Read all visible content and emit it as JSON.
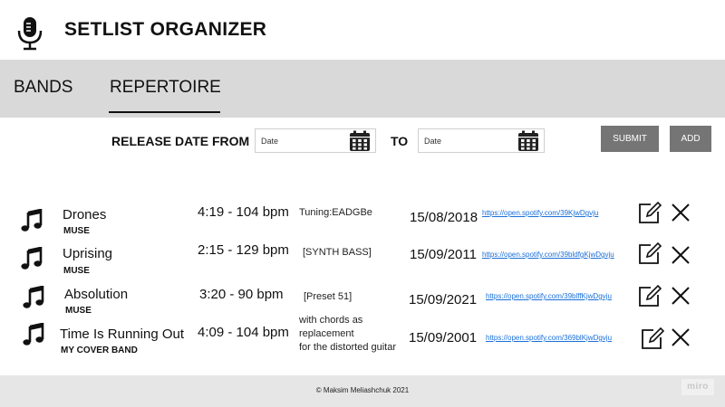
{
  "app": {
    "title": "SETLIST ORGANIZER",
    "logo_icon": "microphone-icon"
  },
  "tabs": [
    {
      "label": "BANDS",
      "active": false
    },
    {
      "label": "REPERTOIRE",
      "active": true
    }
  ],
  "filter": {
    "from_label": "RELEASE DATE FROM",
    "to_label": "TO",
    "from_placeholder": "Date",
    "to_placeholder": "Date",
    "from_value": "",
    "to_value": "",
    "calendar_icon": "calendar-icon"
  },
  "buttons": {
    "submit_label": "SUBMIT",
    "add_label": "ADD",
    "color": "#757575"
  },
  "songs": [
    {
      "title": "Drones",
      "band": "MUSE",
      "duration": "4:19 - 104 bpm",
      "notes": [
        "Tuning:EADGBe"
      ],
      "release_date": "15/08/2018",
      "link": "https://open.spotify.com/39KjwDgvju"
    },
    {
      "title": "Uprising",
      "band": "MUSE",
      "duration": "2:15 - 129 bpm",
      "notes": [
        "[SYNTH BASS]"
      ],
      "release_date": "15/09/2011",
      "link": "https://open.spotify.com/39bldfgKjwDgvju"
    },
    {
      "title": "Absolution",
      "band": "MUSE",
      "duration": "3:20 - 90 bpm",
      "notes": [
        "[Preset 51]"
      ],
      "release_date": "15/09/2021",
      "link": "https://open.spotify.com/39blffKjwDgvju"
    },
    {
      "title": "Time Is Running Out",
      "band": "MY COVER BAND",
      "duration": "4:09 - 104 bpm",
      "notes": [
        "with chords as",
        "replacement",
        "for the distorted guitar"
      ],
      "release_date": "15/09/2001",
      "link": "https://open.spotify.com/369blKjwDgvju"
    }
  ],
  "row_icons": {
    "song": "music-note-icon",
    "edit": "edit-icon",
    "delete": "close-icon"
  },
  "footer": {
    "copyright": "© Maksim Meliashchuk 2021",
    "watermark": "miro"
  },
  "colors": {
    "tabbar_bg": "#d9d9d9",
    "footer_bg": "#e6e6e6",
    "link": "#1a6fd8"
  }
}
